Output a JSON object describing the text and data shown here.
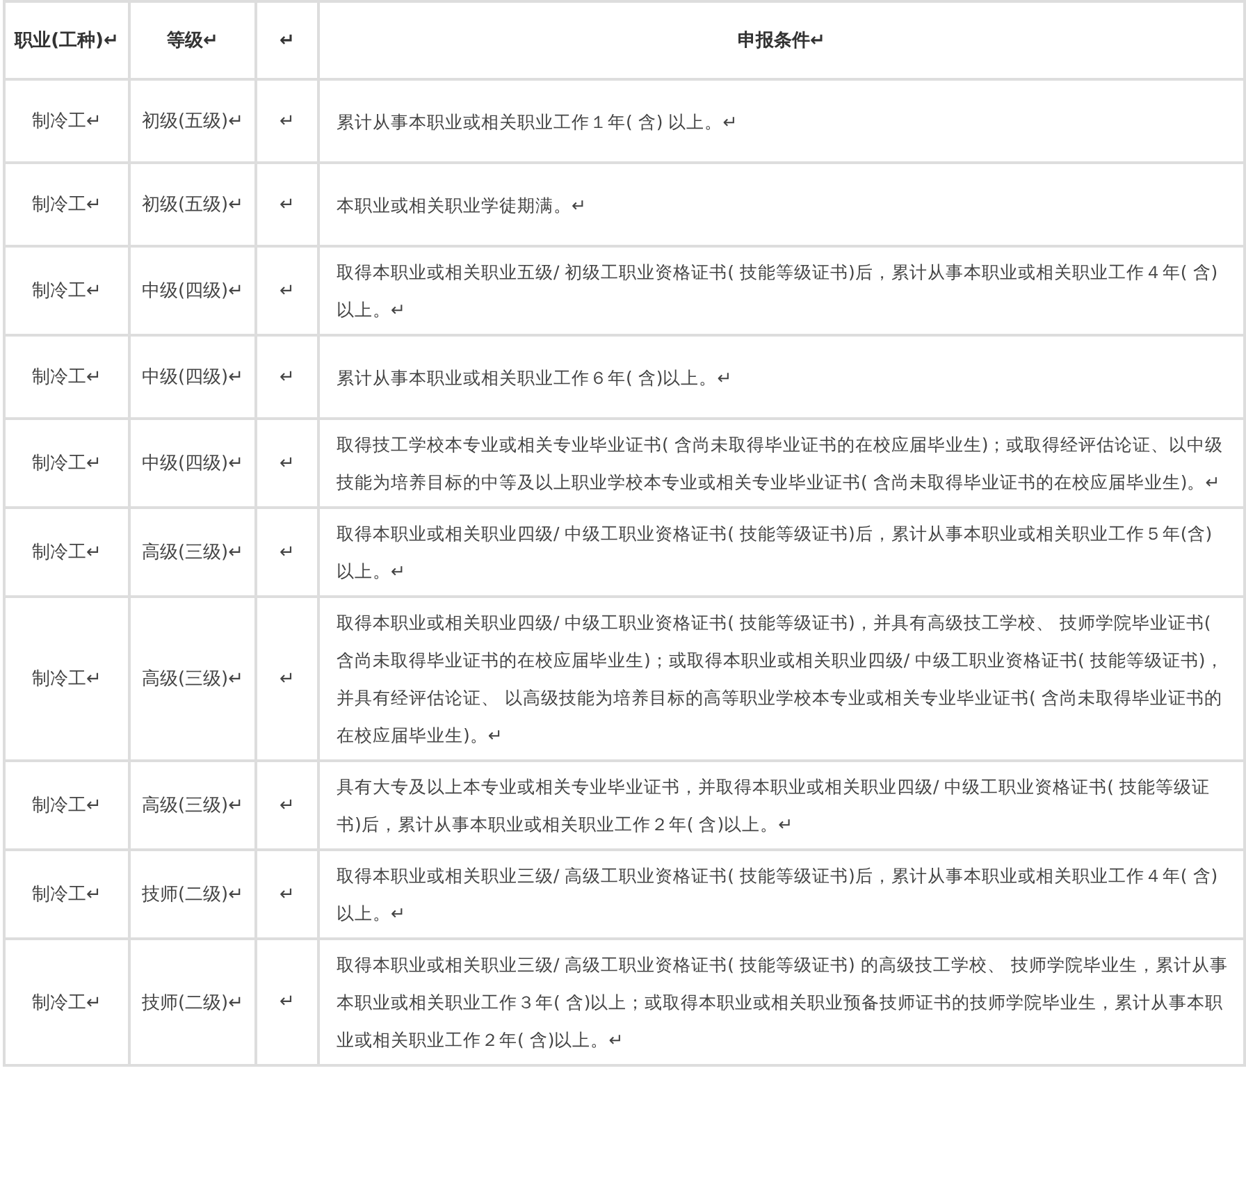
{
  "table": {
    "columns": [
      "职业(工种)↵",
      "等级↵",
      "↵",
      "申报条件↵"
    ],
    "rows": [
      {
        "occupation": "制冷工↵",
        "grade": "初级(五级)↵",
        "column_3": "↵",
        "conditions": "累计从事本职业或相关职业工作１年( 含) 以上。↵"
      },
      {
        "occupation": "制冷工↵",
        "grade": "初级(五级)↵",
        "column_3": "↵",
        "conditions": "本职业或相关职业学徒期满。↵"
      },
      {
        "occupation": "制冷工↵",
        "grade": "中级(四级)↵",
        "column_3": "↵",
        "conditions": "取得本职业或相关职业五级/ 初级工职业资格证书( 技能等级证书)后，累计从事本职业或相关职业工作４年( 含) 以上。↵"
      },
      {
        "occupation": "制冷工↵",
        "grade": "中级(四级)↵",
        "column_3": "↵",
        "conditions": "累计从事本职业或相关职业工作６年( 含)以上。↵"
      },
      {
        "occupation": "制冷工↵",
        "grade": "中级(四级)↵",
        "column_3": "↵",
        "conditions": "取得技工学校本专业或相关专业毕业证书( 含尚未取得毕业证书的在校应届毕业生)；或取得经评估论证、以中级技能为培养目标的中等及以上职业学校本专业或相关专业毕业证书( 含尚未取得毕业证书的在校应届毕业生)。↵"
      },
      {
        "occupation": "制冷工↵",
        "grade": "高级(三级)↵",
        "column_3": "↵",
        "conditions": "取得本职业或相关职业四级/ 中级工职业资格证书( 技能等级证书)后，累计从事本职业或相关职业工作５年(含)以上。↵"
      },
      {
        "occupation": "制冷工↵",
        "grade": "高级(三级)↵",
        "column_3": "↵",
        "conditions": "取得本职业或相关职业四级/ 中级工职业资格证书( 技能等级证书)，并具有高级技工学校、 技师学院毕业证书( 含尚未取得毕业证书的在校应届毕业生)；或取得本职业或相关职业四级/ 中级工职业资格证书( 技能等级证书)，并具有经评估论证、 以高级技能为培养目标的高等职业学校本专业或相关专业毕业证书( 含尚未取得毕业证书的在校应届毕业生)。↵"
      },
      {
        "occupation": "制冷工↵",
        "grade": "高级(三级)↵",
        "column_3": "↵",
        "conditions": "具有大专及以上本专业或相关专业毕业证书，并取得本职业或相关职业四级/ 中级工职业资格证书( 技能等级证书)后，累计从事本职业或相关职业工作２年( 含)以上。↵"
      },
      {
        "occupation": "制冷工↵",
        "grade": "技师(二级)↵",
        "column_3": "↵",
        "conditions": "取得本职业或相关职业三级/ 高级工职业资格证书( 技能等级证书)后，累计从事本职业或相关职业工作４年( 含)以上。↵"
      },
      {
        "occupation": "制冷工↵",
        "grade": "技师(二级)↵",
        "column_3": "↵",
        "conditions": "取得本职业或相关职业三级/ 高级工职业资格证书( 技能等级证书) 的高级技工学校、 技师学院毕业生，累计从事本职业或相关职业工作３年( 含)以上；或取得本职业或相关职业预备技师证书的技师学院毕业生，累计从事本职业或相关职业工作２年( 含)以上。↵"
      }
    ]
  }
}
